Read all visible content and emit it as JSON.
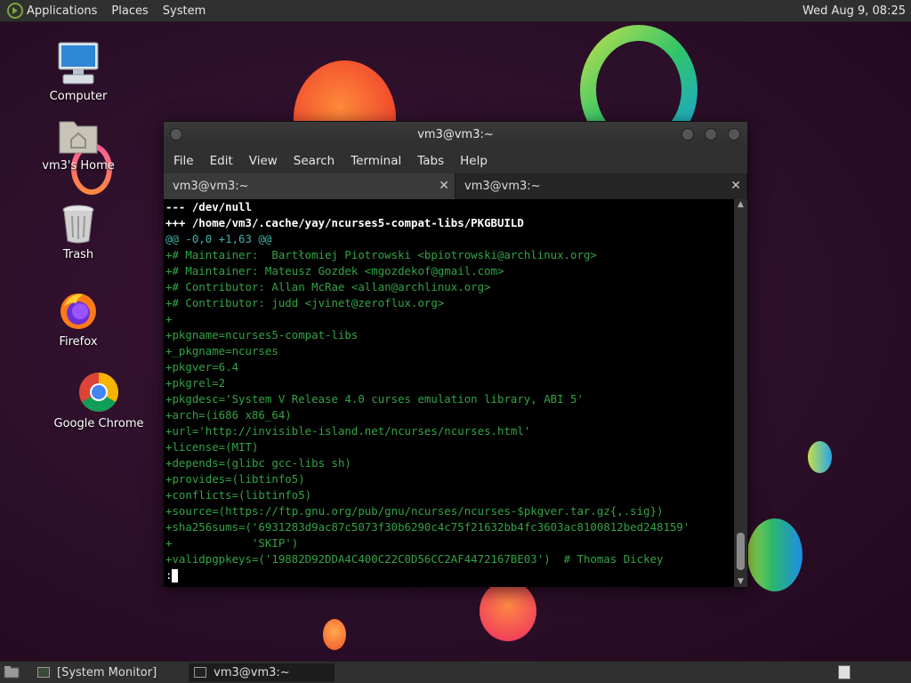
{
  "top_panel": {
    "menus": [
      "Applications",
      "Places",
      "System"
    ],
    "clock": "Wed Aug  9, 08:25"
  },
  "desktop_icons": [
    {
      "label": "Computer",
      "icon": "computer-icon"
    },
    {
      "label": "vm3's Home",
      "icon": "home-folder-icon"
    },
    {
      "label": "Trash",
      "icon": "trash-icon"
    },
    {
      "label": "Firefox",
      "icon": "firefox-icon"
    },
    {
      "label": "Google Chrome",
      "icon": "chrome-icon"
    }
  ],
  "terminal": {
    "title": "vm3@vm3:~",
    "menus": [
      "File",
      "Edit",
      "View",
      "Search",
      "Terminal",
      "Tabs",
      "Help"
    ],
    "tabs": [
      {
        "label": "vm3@vm3:~",
        "close": "✕",
        "active": true
      },
      {
        "label": "vm3@vm3:~",
        "close": "✕",
        "active": false
      }
    ],
    "lines": [
      {
        "text": "--- /dev/null",
        "style": "bold"
      },
      {
        "text": "+++ /home/vm3/.cache/yay/ncurses5-compat-libs/PKGBUILD",
        "style": "bold"
      },
      {
        "text": "@@ -0,0 +1,63 @@",
        "style": "hunk"
      },
      {
        "text": "+# Maintainer:  Bartłomiej Piotrowski <bpiotrowski@archlinux.org>",
        "style": "add"
      },
      {
        "text": "+# Maintainer: Mateusz Gozdek <mgozdekof@gmail.com>",
        "style": "add"
      },
      {
        "text": "+# Contributor: Allan McRae <allan@archlinux.org>",
        "style": "add"
      },
      {
        "text": "+# Contributor: judd <jvinet@zeroflux.org>",
        "style": "add"
      },
      {
        "text": "+",
        "style": "add"
      },
      {
        "text": "+pkgname=ncurses5-compat-libs",
        "style": "add"
      },
      {
        "text": "+_pkgname=ncurses",
        "style": "add"
      },
      {
        "text": "+pkgver=6.4",
        "style": "add"
      },
      {
        "text": "+pkgrel=2",
        "style": "add"
      },
      {
        "text": "+pkgdesc='System V Release 4.0 curses emulation library, ABI 5'",
        "style": "add"
      },
      {
        "text": "+arch=(i686 x86_64)",
        "style": "add"
      },
      {
        "text": "+url='http://invisible-island.net/ncurses/ncurses.html'",
        "style": "add"
      },
      {
        "text": "+license=(MIT)",
        "style": "add"
      },
      {
        "text": "+depends=(glibc gcc-libs sh)",
        "style": "add"
      },
      {
        "text": "+provides=(libtinfo5)",
        "style": "add"
      },
      {
        "text": "+conflicts=(libtinfo5)",
        "style": "add"
      },
      {
        "text": "+source=(https://ftp.gnu.org/pub/gnu/ncurses/ncurses-$pkgver.tar.gz{,.sig})",
        "style": "add"
      },
      {
        "text": "+sha256sums=('6931283d9ac87c5073f30b6290c4c75f21632bb4fc3603ac8100812bed248159'",
        "style": "add"
      },
      {
        "text": "+            'SKIP')",
        "style": "add"
      },
      {
        "text": "+validpgpkeys=('19882D92DDA4C400C22C0D56CC2AF4472167BE03')  # Thomas Dickey",
        "style": "add"
      }
    ],
    "prompt": ":"
  },
  "bottom_panel": {
    "tasks": [
      {
        "label": "[System Monitor]",
        "active": false
      },
      {
        "label": "vm3@vm3:~",
        "active": true
      }
    ]
  },
  "colors": {
    "diff_add": "#33a345",
    "diff_hunk": "#3fb3a8",
    "panel_bg": "#303030"
  }
}
